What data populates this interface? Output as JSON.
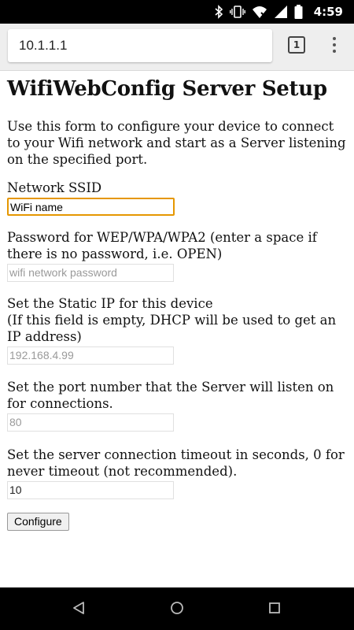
{
  "status_bar": {
    "time": "4:59",
    "icons": [
      "bluetooth-icon",
      "vibrate-icon",
      "wifi-icon",
      "signal-icon",
      "battery-icon"
    ]
  },
  "browser": {
    "url": "10.1.1.1",
    "tab_count": "1"
  },
  "page": {
    "title": "WifiWebConfig Server Setup",
    "intro": "Use this form to configure your device to connect to your Wifi network and start as a Server listening on the specified port.",
    "fields": [
      {
        "label": "Network SSID",
        "value": "WiFi name",
        "placeholder": ""
      },
      {
        "label": "Password for WEP/WPA/WPA2 (enter a space if there is no password, i.e. OPEN)",
        "value": "",
        "placeholder": "wifi network password"
      },
      {
        "label_line1": "Set the Static IP for this device",
        "label_line2": "(If this field is empty, DHCP will be used to get an IP address)",
        "value": "",
        "placeholder": "192.168.4.99"
      },
      {
        "label": "Set the port number that the Server will listen on for connections.",
        "value": "",
        "placeholder": "80"
      },
      {
        "label": "Set the server connection timeout in seconds, 0 for never timeout (not recommended).",
        "value": "10",
        "placeholder": ""
      }
    ],
    "submit_label": "Configure"
  },
  "colors": {
    "focus_border": "#e59700",
    "toolbar_bg": "#eeeeee"
  }
}
